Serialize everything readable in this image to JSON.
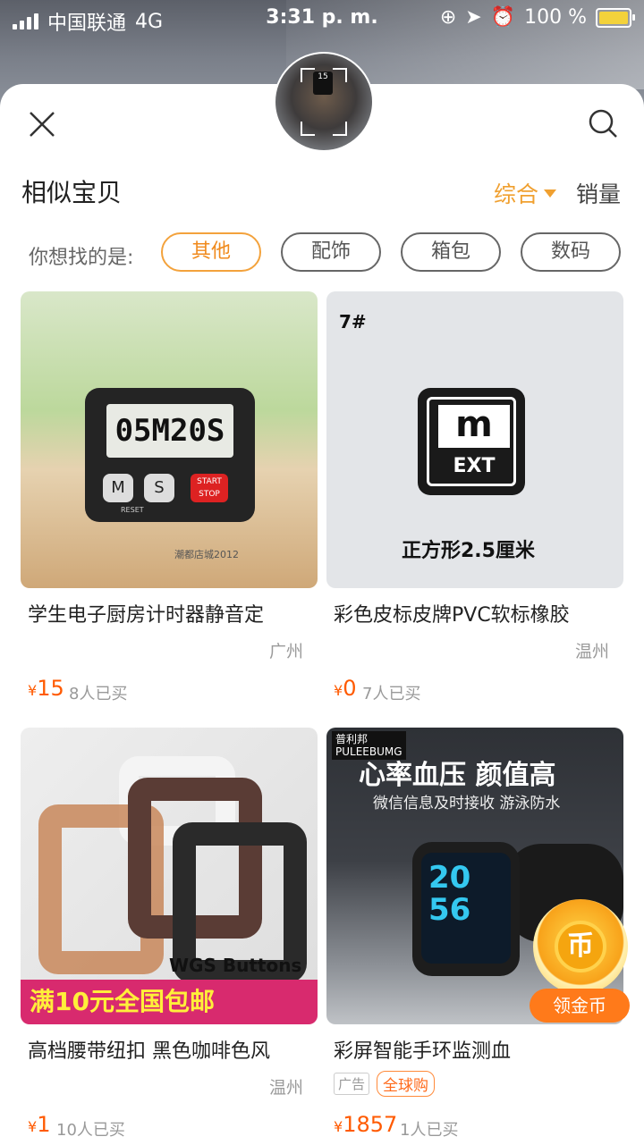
{
  "status_bar": {
    "carrier": "中国联通",
    "network": "4G",
    "time": "3:31 p. m.",
    "battery": "100 %"
  },
  "header": {
    "title": "相似宝贝",
    "sort_active": "综合",
    "sort_sales": "销量"
  },
  "filters": {
    "prompt": "你想找的是:",
    "chips": [
      "其他",
      "配饰",
      "箱包",
      "数码"
    ]
  },
  "products": [
    {
      "name": "学生电子厨房计时器静音定",
      "location": "广州",
      "price": "15",
      "sold": "8人已买",
      "image_text": {
        "display": "05M20S",
        "btn_m": "M",
        "btn_s": "S",
        "btn_stop": "START STOP",
        "reset": "RESET",
        "watermark": "潮都店城2012"
      }
    },
    {
      "name": "彩色皮标皮牌PVC软标橡胶",
      "location": "温州",
      "price": "0",
      "sold": "7人已买",
      "image_text": {
        "code": "7#",
        "logo_m": "m",
        "logo_ext": "EXT",
        "caption": "正方形2.5厘米"
      }
    },
    {
      "name": "高档腰带纽扣 黑色咖啡色风",
      "location": "温州",
      "price": "1",
      "sold": "10人已买",
      "image_text": {
        "brand": "WGS Buttons",
        "promo": "满10元全国包邮"
      }
    },
    {
      "name": "彩屏智能手环监测血",
      "ad_tag": "广告",
      "global_tag": "全球购",
      "price": "1857",
      "sold": "1人已买",
      "image_text": {
        "brand_cn": "普利邦",
        "brand_en": "PULEEBUMG",
        "headline": "心率血压 颜值高",
        "subline": "微信信息及时接收 游泳防水",
        "screen": "20 56"
      }
    }
  ],
  "coin": {
    "glyph": "币",
    "label": "领金币"
  },
  "colors": {
    "accent": "#f0a030",
    "price": "#ff5a00",
    "coin": "#ff7a1a"
  }
}
